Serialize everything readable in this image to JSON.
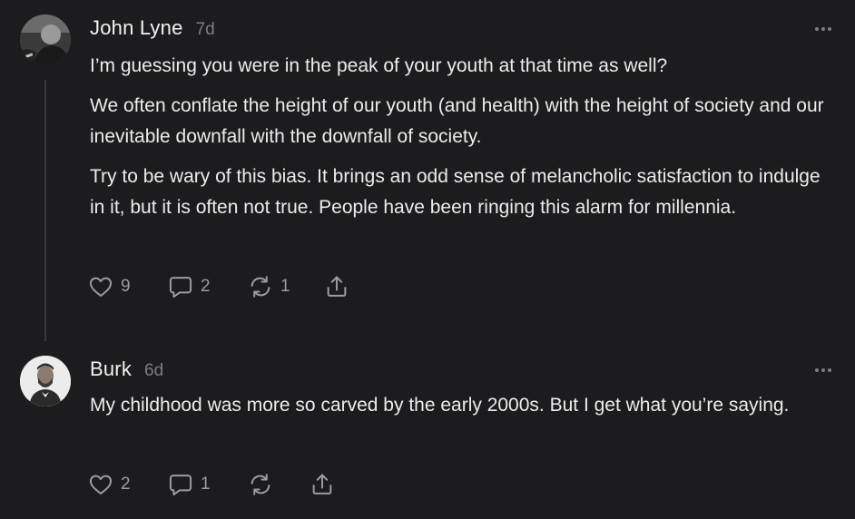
{
  "comments": [
    {
      "author": "John Lyne",
      "time": "7d",
      "paragraphs": [
        "I’m guessing you were in the peak of your youth at that time as well?",
        "We often conflate the height of our youth (and health) with the height of society and our inevitable downfall with the downfall of society.",
        "Try to be wary of this bias. It brings an odd sense of melancholic satisfaction to indulge in it, but it is often not true. People have been ringing this alarm for millennia."
      ],
      "likes": "9",
      "replies": "2",
      "restacks": "1"
    },
    {
      "author": "Burk",
      "time": "6d",
      "paragraphs": [
        "My childhood was more so carved by the early 2000s. But I get what you’re saying."
      ],
      "likes": "2",
      "replies": "1",
      "restacks": ""
    }
  ],
  "icons": {
    "like": "heart-icon",
    "reply": "speech-bubble-icon",
    "restack": "restack-arrows-icon",
    "share": "share-upload-icon",
    "more": "ellipsis-icon"
  },
  "colors": {
    "background": "#1c1c1e",
    "text": "#ececec",
    "muted": "#7d7d82",
    "icon": "#9c9ca1"
  }
}
